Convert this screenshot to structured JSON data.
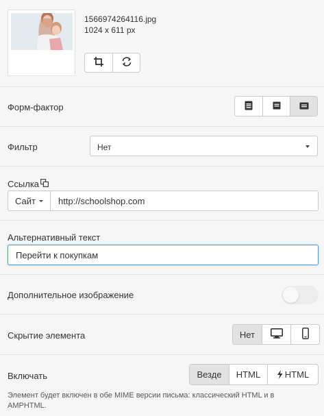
{
  "image": {
    "filename": "1566974264116.jpg",
    "dimensions": "1024 x 611 px",
    "actions": [
      "crop-icon",
      "refresh-icon"
    ]
  },
  "form_factor": {
    "label": "Форм-фактор",
    "options": [
      "full-width-icon",
      "medium-width-icon",
      "compact-width-icon"
    ],
    "selected_index": 2
  },
  "filter": {
    "label": "Фильтр",
    "value": "Нет"
  },
  "link": {
    "label": "Ссылка",
    "type": "Сайт",
    "url": "http://schoolshop.com"
  },
  "alt_text": {
    "label": "Альтернативный текст",
    "value": "Перейти к покупкам"
  },
  "extra_image": {
    "label": "Дополнительное изображение",
    "enabled": false
  },
  "hide_element": {
    "label": "Скрытие элемента",
    "options": [
      "Нет",
      "desktop-icon",
      "mobile-icon"
    ],
    "selected": "Нет"
  },
  "include": {
    "label": "Включать",
    "options": [
      "Везде",
      "HTML",
      "HTML"
    ],
    "selected": "Везде",
    "note": "Элемент будет включен в обе MIME версии письма: классический HTML и в AMPHTML."
  },
  "colors": {
    "background": "#f6f6f6",
    "active_button": "#e2e2e2",
    "focus_border": "#5b9bd5"
  }
}
